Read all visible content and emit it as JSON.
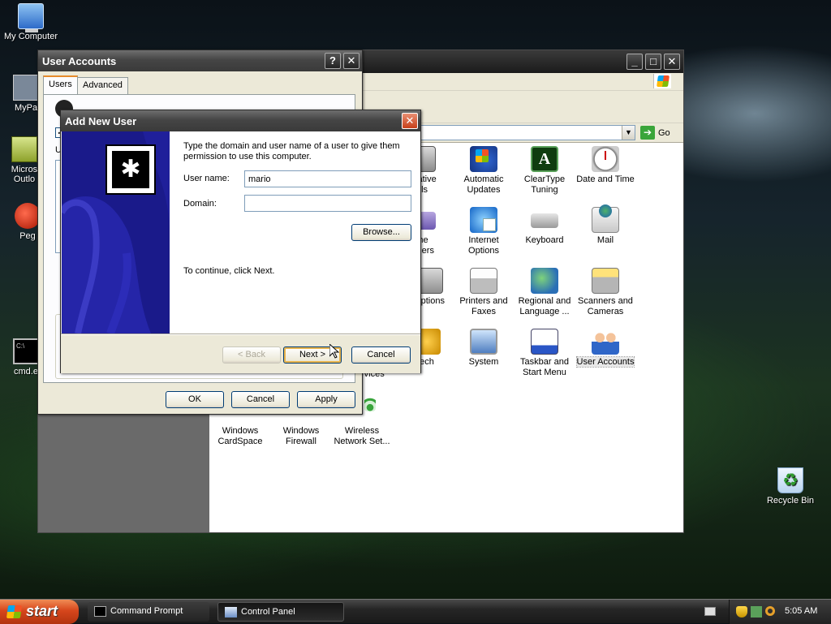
{
  "desktop": {
    "icons": [
      {
        "label": "My Computer"
      },
      {
        "label": "MyPa"
      },
      {
        "label": "Micros"
      },
      {
        "label": "Outlo"
      },
      {
        "label": "Peg"
      },
      {
        "label": "cmd.e"
      },
      {
        "label": "Recycle Bin"
      }
    ]
  },
  "control_panel": {
    "go_label": "Go",
    "items": [
      {
        "label": "strative",
        "label2": "ols",
        "icon": "administrative-tools-icon"
      },
      {
        "label": "Automatic",
        "label2": "Updates",
        "icon": "automatic-updates-icon"
      },
      {
        "label": "ClearType",
        "label2": "Tuning",
        "icon": "cleartype-tuning-icon"
      },
      {
        "label": "Date and Time",
        "label2": "",
        "icon": "date-and-time-icon"
      },
      {
        "label": "me",
        "label2": "rollers",
        "icon": "game-controllers-icon"
      },
      {
        "label": "Internet",
        "label2": "Options",
        "icon": "internet-options-icon"
      },
      {
        "label": "Keyboard",
        "label2": "",
        "icon": "keyboard-icon"
      },
      {
        "label": "Mail",
        "label2": "",
        "icon": "mail-icon"
      },
      {
        "label": "Options",
        "label2": "",
        "icon": "power-options-icon"
      },
      {
        "label": "Printers and",
        "label2": "Faxes",
        "icon": "printers-and-faxes-icon"
      },
      {
        "label": "Regional and",
        "label2": "Language ...",
        "icon": "regional-and-language-icon"
      },
      {
        "label": "Scanners and",
        "label2": "Cameras",
        "icon": "scanners-and-cameras-icon"
      },
      {
        "label": "ech",
        "label2": "",
        "icon": "speech-icon"
      },
      {
        "label": "System",
        "label2": "",
        "icon": "system-icon"
      },
      {
        "label": "Taskbar and",
        "label2": "Start Menu",
        "icon": "taskbar-and-start-menu-icon"
      },
      {
        "label": "User Accounts",
        "label2": "",
        "icon": "user-accounts-icon"
      },
      {
        "label": "Windows",
        "label2": "CardSpace",
        "icon": "windows-cardspace-icon"
      },
      {
        "label": "Windows",
        "label2": "Firewall",
        "icon": "windows-firewall-icon"
      },
      {
        "label": "Wireless",
        "label2": "Network Set...",
        "icon": "wireless-network-setup-icon"
      }
    ],
    "partial_text": "rvices"
  },
  "user_accounts": {
    "title": "User Accounts",
    "help": "?",
    "close": "✕",
    "tabs": [
      "Users",
      "Advanced"
    ],
    "partial_user_label": "U",
    "buttons": {
      "ok": "OK",
      "cancel": "Cancel",
      "apply": "Apply"
    }
  },
  "add_new_user": {
    "title": "Add New User",
    "close": "✕",
    "intro": "Type the domain and user name of a user to give them permission to use this computer.",
    "user_name_label": "User name:",
    "user_name_value": "mario",
    "domain_label": "Domain:",
    "domain_value": "",
    "browse": "Browse...",
    "continue_text": "To continue, click Next.",
    "back": "< Back",
    "next": "Next >",
    "cancel": "Cancel"
  },
  "taskbar": {
    "start": "start",
    "tasks": [
      {
        "label": "Command Prompt"
      },
      {
        "label": "Control Panel"
      }
    ],
    "clock": "5:05 AM"
  },
  "colors": {
    "start_orange": "#d6461c",
    "banner_blue": "#1a1a8a",
    "default_button_glow": "#e9b44c"
  }
}
